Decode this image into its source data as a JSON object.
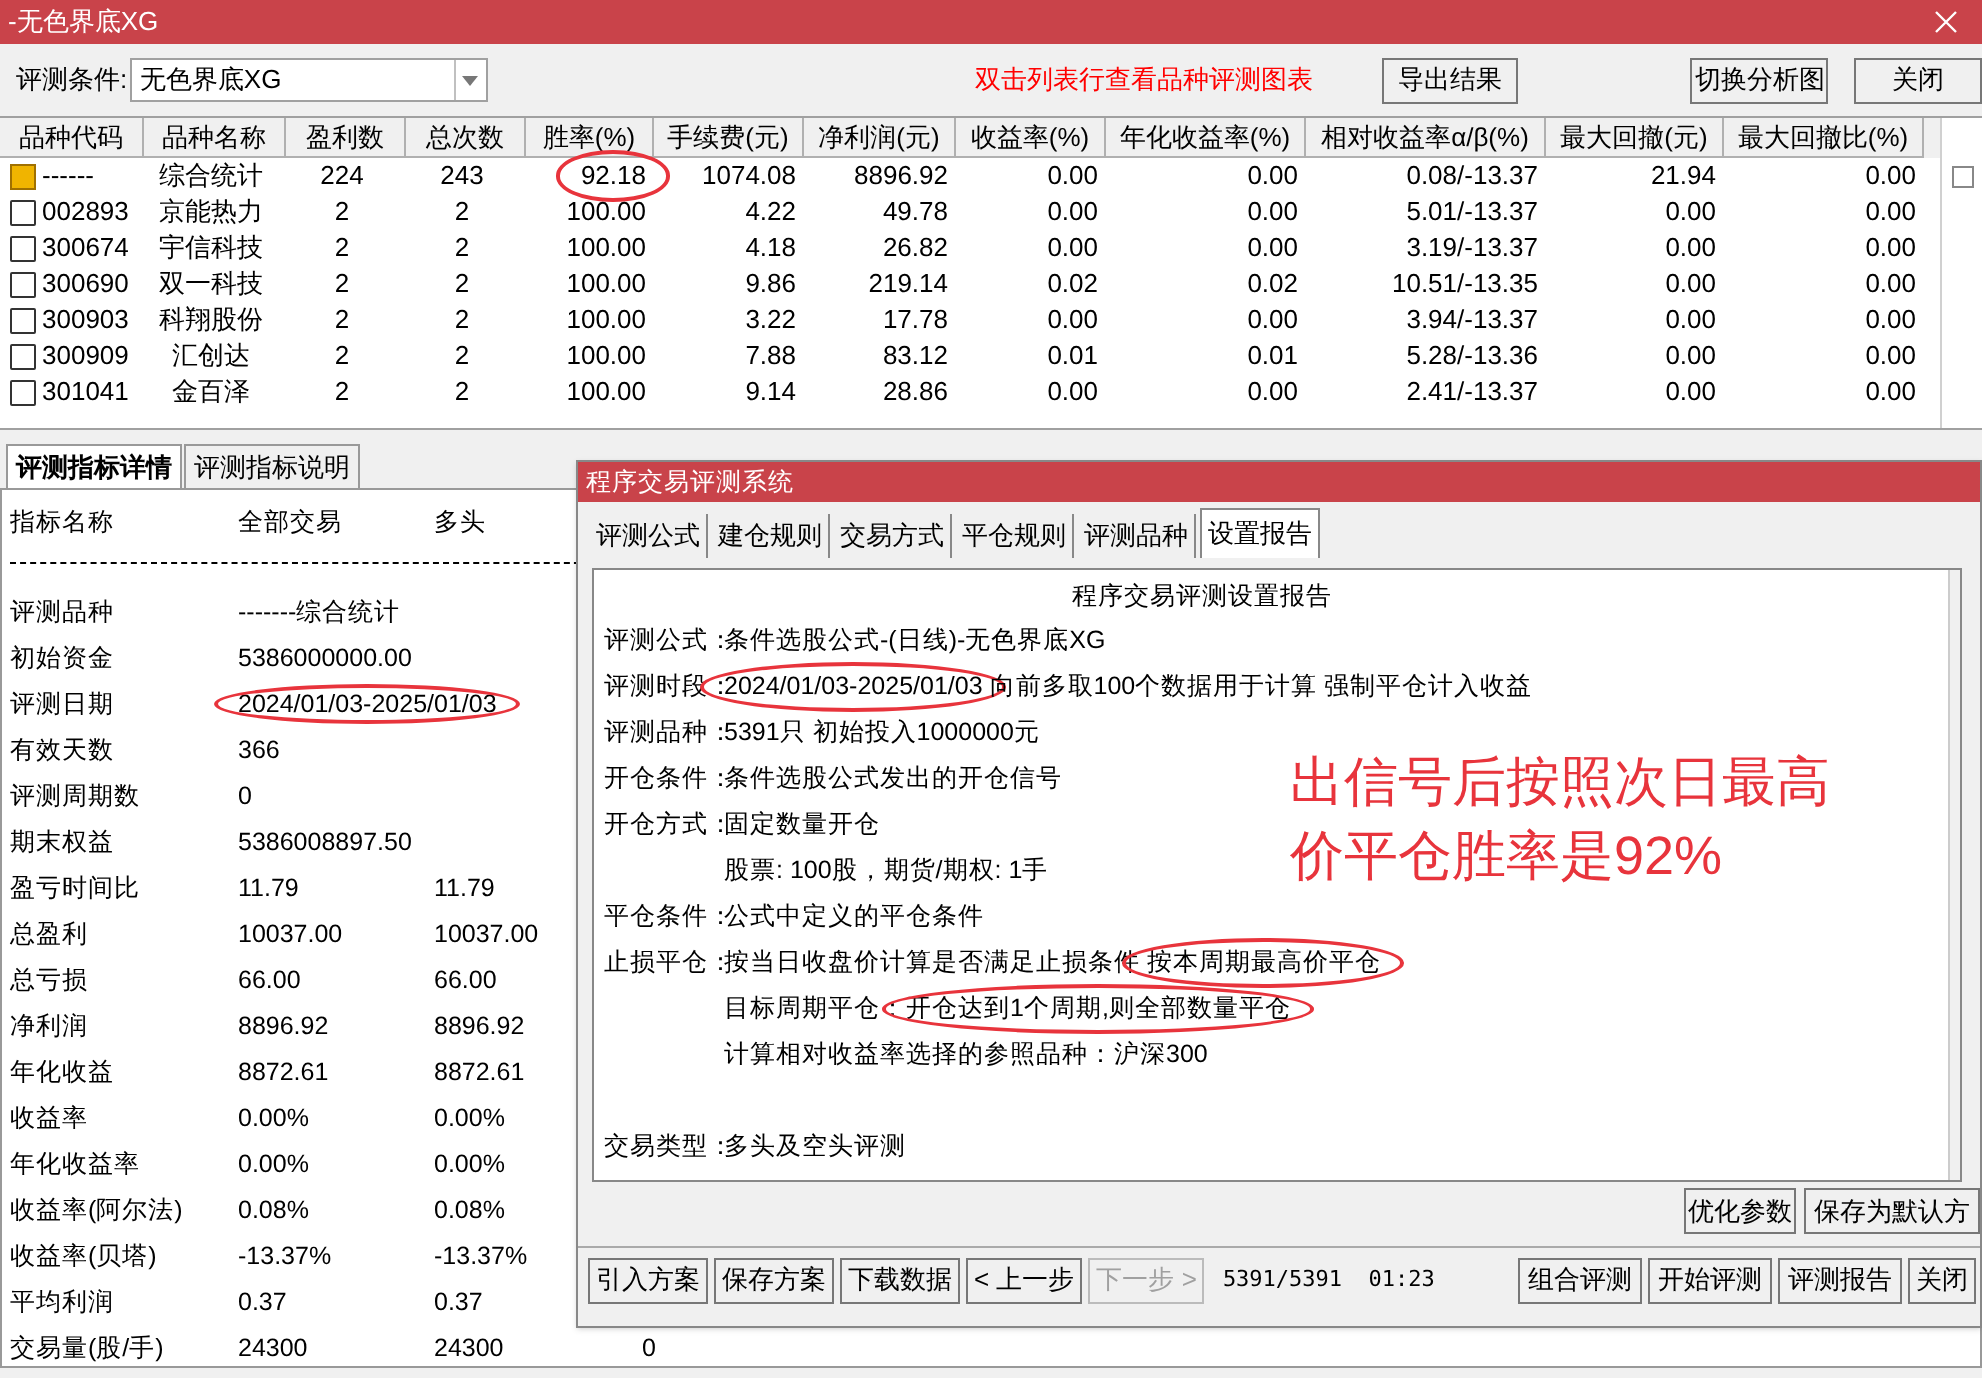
{
  "window": {
    "title": "-无色界底XG"
  },
  "toolbar": {
    "condition_label": "评测条件:",
    "condition_value": "无色界底XG",
    "hint": "双击列表行查看品种评测图表",
    "buttons": [
      "导出结果",
      "切换分析图",
      "关闭"
    ]
  },
  "table": {
    "checkbox": {
      "checked": false
    },
    "columns": [
      "品种代码",
      "品种名称",
      "盈利数",
      "总次数",
      "胜率(%)",
      "手续费(元)",
      "净利润(元)",
      "收益率(%)",
      "年化收益率(%)",
      "相对收益率α/β(%)",
      "最大回撤(元)",
      "最大回撤比(%)"
    ],
    "rows": [
      {
        "kind": "summary",
        "win_rate_circled": true,
        "cells": [
          "------",
          "综合统计",
          "224",
          "243",
          "92.18",
          "1074.08",
          "8896.92",
          "0.00",
          "0.00",
          "0.08/-13.37",
          "21.94",
          "0.00"
        ]
      },
      {
        "kind": "stock",
        "win_rate_circled": false,
        "cells": [
          "002893",
          "京能热力",
          "2",
          "2",
          "100.00",
          "4.22",
          "49.78",
          "0.00",
          "0.00",
          "5.01/-13.37",
          "0.00",
          "0.00"
        ]
      },
      {
        "kind": "stock",
        "win_rate_circled": false,
        "cells": [
          "300674",
          "宇信科技",
          "2",
          "2",
          "100.00",
          "4.18",
          "26.82",
          "0.00",
          "0.00",
          "3.19/-13.37",
          "0.00",
          "0.00"
        ]
      },
      {
        "kind": "stock",
        "win_rate_circled": false,
        "cells": [
          "300690",
          "双一科技",
          "2",
          "2",
          "100.00",
          "9.86",
          "219.14",
          "0.02",
          "0.02",
          "10.51/-13.35",
          "0.00",
          "0.00"
        ]
      },
      {
        "kind": "stock",
        "win_rate_circled": false,
        "cells": [
          "300903",
          "科翔股份",
          "2",
          "2",
          "100.00",
          "3.22",
          "17.78",
          "0.00",
          "0.00",
          "3.94/-13.37",
          "0.00",
          "0.00"
        ]
      },
      {
        "kind": "stock",
        "win_rate_circled": false,
        "cells": [
          "300909",
          "汇创达",
          "2",
          "2",
          "100.00",
          "7.88",
          "83.12",
          "0.01",
          "0.01",
          "5.28/-13.36",
          "0.00",
          "0.00"
        ]
      },
      {
        "kind": "stock",
        "win_rate_circled": false,
        "cells": [
          "301041",
          "金百泽",
          "2",
          "2",
          "100.00",
          "9.14",
          "28.86",
          "0.00",
          "0.00",
          "2.41/-13.37",
          "0.00",
          "0.00"
        ]
      }
    ]
  },
  "detail_panel": {
    "tabs": [
      {
        "label": "评测指标详情",
        "selected": true
      },
      {
        "label": "评测指标说明",
        "selected": false
      }
    ],
    "header": [
      "指标名称",
      "全部交易",
      "多头"
    ],
    "rows": [
      {
        "label": "评测品种",
        "circled": false,
        "values": [
          "-------综合统计"
        ]
      },
      {
        "label": "初始资金",
        "circled": false,
        "values": [
          "5386000000.00"
        ]
      },
      {
        "label": "评测日期",
        "circled": true,
        "values": [
          "2024/01/03-2025/01/03"
        ]
      },
      {
        "label": "有效天数",
        "circled": false,
        "values": [
          "366"
        ]
      },
      {
        "label": "评测周期数",
        "circled": false,
        "values": [
          "0"
        ]
      },
      {
        "label": "期末权益",
        "circled": false,
        "values": [
          "5386008897.50"
        ]
      },
      {
        "label": "盈亏时间比",
        "circled": false,
        "values": [
          "11.79",
          "11.79"
        ]
      },
      {
        "label": "总盈利",
        "circled": false,
        "values": [
          "10037.00",
          "10037.00"
        ]
      },
      {
        "label": "总亏损",
        "circled": false,
        "values": [
          "66.00",
          "66.00"
        ]
      },
      {
        "label": "净利润",
        "circled": false,
        "values": [
          "8896.92",
          "8896.92"
        ]
      },
      {
        "label": "年化收益",
        "circled": false,
        "values": [
          "8872.61",
          "8872.61"
        ]
      },
      {
        "label": "收益率",
        "circled": false,
        "values": [
          "0.00%",
          "0.00%"
        ]
      },
      {
        "label": "年化收益率",
        "circled": false,
        "values": [
          "0.00%",
          "0.00%"
        ]
      },
      {
        "label": "收益率(阿尔法)",
        "circled": false,
        "values": [
          "0.08%",
          "0.08%"
        ]
      },
      {
        "label": "收益率(贝塔)",
        "circled": false,
        "values": [
          "-13.37%",
          "-13.37%"
        ]
      },
      {
        "label": "平均利润",
        "circled": false,
        "values": [
          "0.37",
          "0.37"
        ]
      },
      {
        "label": "交易量(股/手)",
        "circled": false,
        "values": [
          "24300",
          "24300",
          "0"
        ]
      }
    ]
  },
  "dialog": {
    "title": "程序交易评测系统",
    "tabs": [
      {
        "label": "评测公式",
        "selected": false
      },
      {
        "label": "建仓规则",
        "selected": false
      },
      {
        "label": "交易方式",
        "selected": false
      },
      {
        "label": "平仓规则",
        "selected": false
      },
      {
        "label": "评测品种",
        "selected": false
      },
      {
        "label": "设置报告",
        "selected": true
      }
    ],
    "report": {
      "title": "程序交易评测设置报告",
      "lines": [
        {
          "kind": "field",
          "label": "评测公式：",
          "segments": [
            {
              "text": "条件选股公式-(日线)-无色界底XG",
              "circled": false
            }
          ]
        },
        {
          "kind": "field",
          "label": "评测时段：",
          "segments": [
            {
              "text": "2024/01/03-2025/01/03",
              "circled": true
            },
            {
              "text": " 向前多取100个数据用于计算 强制平仓计入收益",
              "circled": false
            }
          ]
        },
        {
          "kind": "field",
          "label": "评测品种：",
          "segments": [
            {
              "text": "5391只 初始投入1000000元",
              "circled": false
            }
          ]
        },
        {
          "kind": "field",
          "label": "开仓条件：",
          "segments": [
            {
              "text": "条件选股公式发出的开仓信号",
              "circled": false
            }
          ]
        },
        {
          "kind": "field",
          "label": "开仓方式：",
          "segments": [
            {
              "text": "固定数量开仓",
              "circled": false
            }
          ]
        },
        {
          "kind": "indent",
          "segments": [
            {
              "text": "股票: 100股，期货/期权: 1手",
              "circled": false
            }
          ]
        },
        {
          "kind": "field",
          "label": "平仓条件：",
          "segments": [
            {
              "text": "公式中定义的平仓条件",
              "circled": false
            }
          ]
        },
        {
          "kind": "field",
          "label": "止损平仓：",
          "segments": [
            {
              "text": "按当日收盘价计算是否满足止损条件 ",
              "circled": false
            },
            {
              "text": "按本周期最高价平仓",
              "circled": true
            }
          ]
        },
        {
          "kind": "indent",
          "segments": [
            {
              "text": "目标周期平仓：",
              "circled": false
            },
            {
              "text": "开仓达到1个周期,则全部数量平仓",
              "circled": true
            }
          ]
        },
        {
          "kind": "indent",
          "segments": [
            {
              "text": "计算相对收益率选择的参照品种：沪深300",
              "circled": false
            }
          ]
        },
        {
          "kind": "gap"
        },
        {
          "kind": "field",
          "label": "交易类型：",
          "segments": [
            {
              "text": "多头及空头评测",
              "circled": false
            }
          ]
        }
      ]
    },
    "annotation": "出信号后按照次日最高价平仓胜率是92%",
    "buttons_top": [
      "优化参数",
      "保存为默认方"
    ],
    "buttons_bottom": [
      {
        "label": "引入方案",
        "disabled": false
      },
      {
        "label": "保存方案",
        "disabled": false
      },
      {
        "label": "下载数据",
        "disabled": false
      },
      {
        "label": "< 上一步",
        "disabled": false
      },
      {
        "label": "下一步 >",
        "disabled": true
      }
    ],
    "status": "5391/5391  01:23",
    "buttons_right": [
      "组合评测",
      "开始评测",
      "评测报告",
      "关闭"
    ]
  }
}
